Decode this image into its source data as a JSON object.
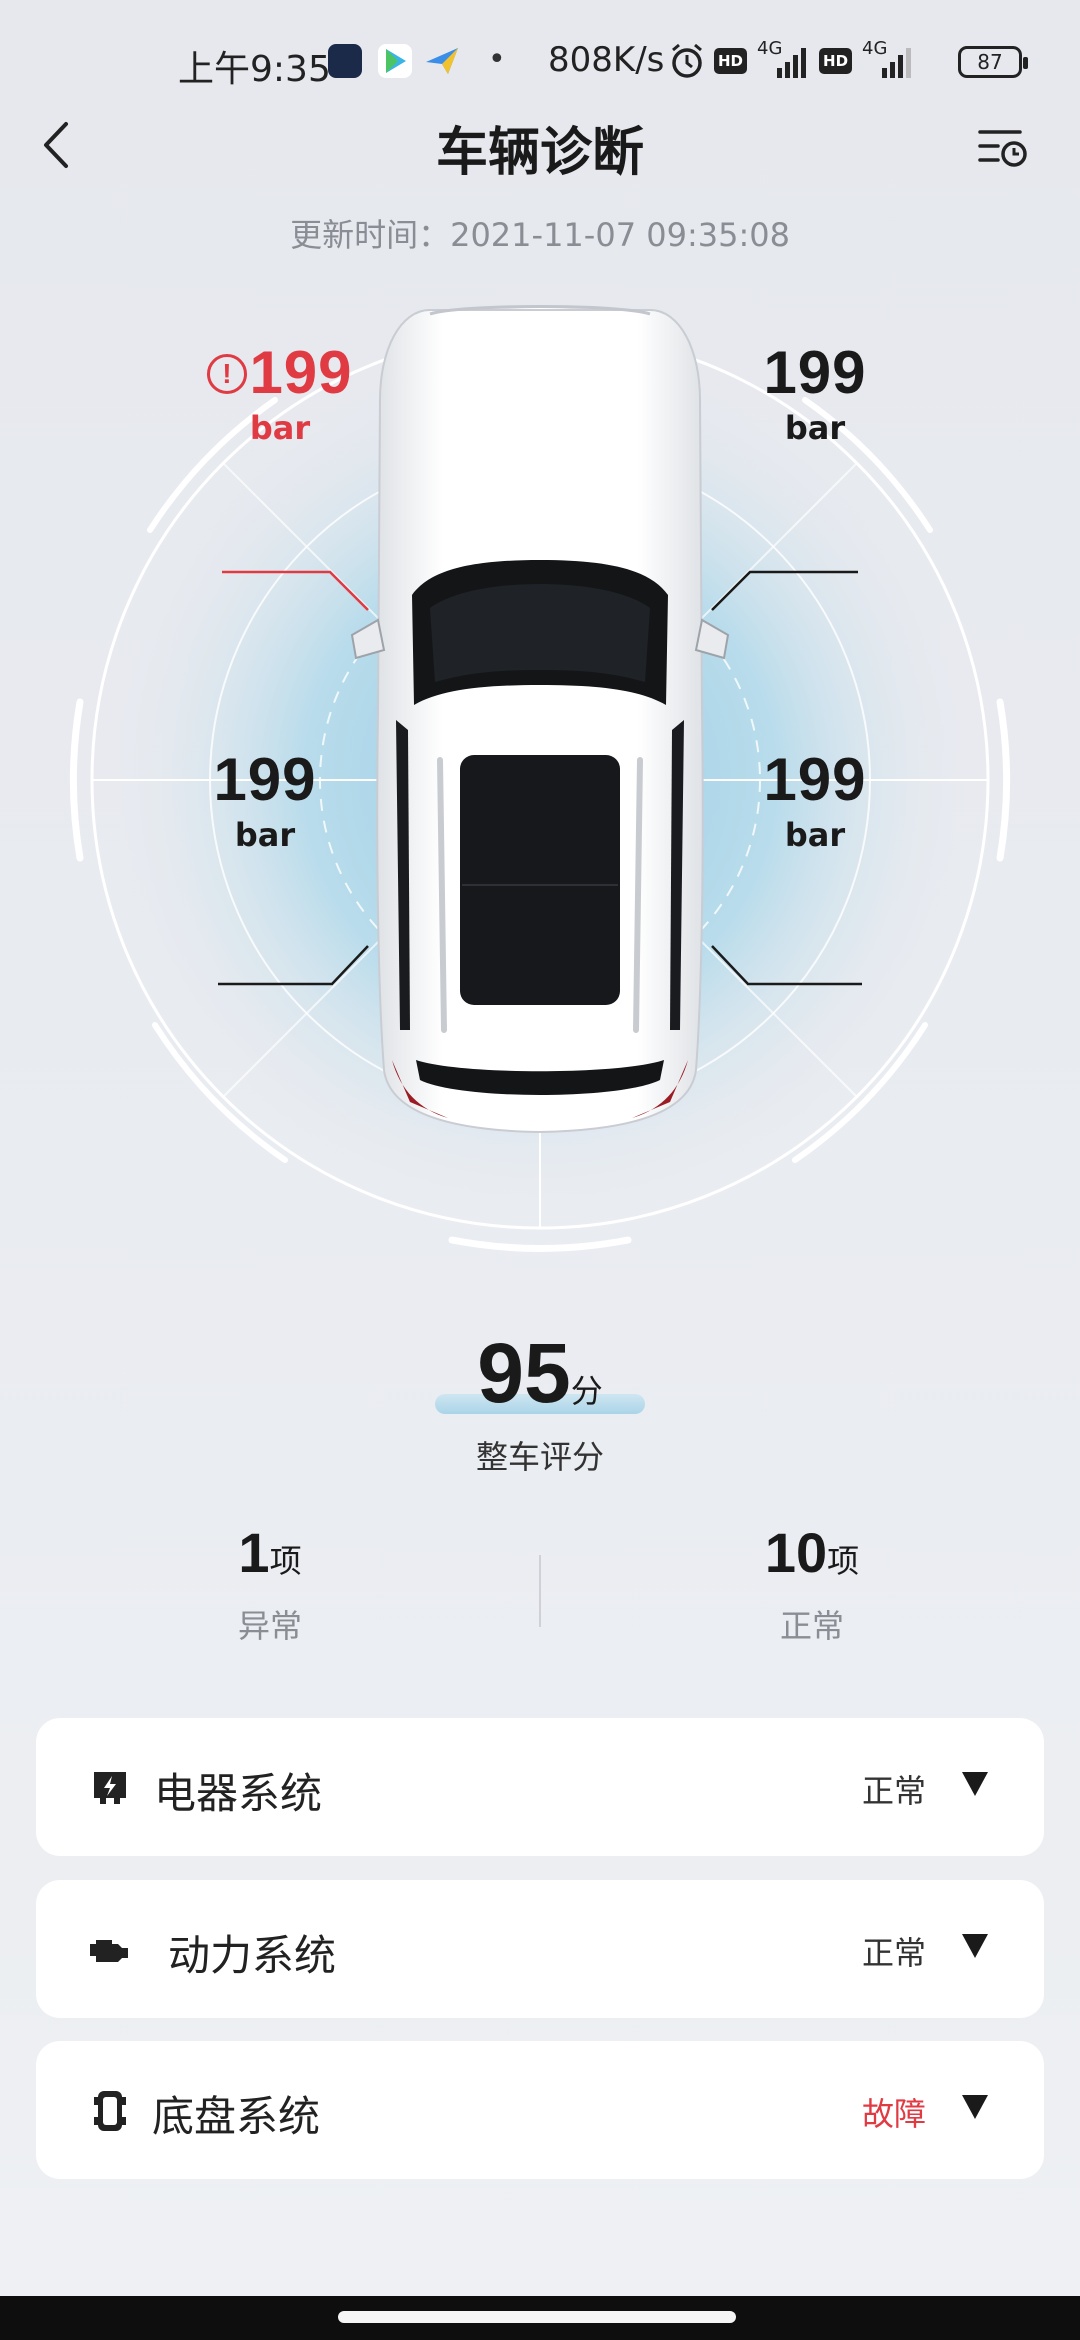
{
  "status_bar": {
    "time": "上午9:35",
    "net_speed": "808K/s",
    "hd1": "HD",
    "net1": "4G",
    "hd2": "HD",
    "net2": "4G",
    "battery": "87"
  },
  "header": {
    "title": "车辆诊断",
    "update_label": "更新时间：",
    "update_time": "2021-11-07 09:35:08"
  },
  "tires": {
    "front_left": {
      "value": "199",
      "unit": "bar",
      "status": "alert"
    },
    "front_right": {
      "value": "199",
      "unit": "bar",
      "status": "normal"
    },
    "rear_left": {
      "value": "199",
      "unit": "bar",
      "status": "normal"
    },
    "rear_right": {
      "value": "199",
      "unit": "bar",
      "status": "normal"
    }
  },
  "warning_symbol": "!",
  "score": {
    "value": "95",
    "unit": "分",
    "label": "整车评分"
  },
  "stats": {
    "abnormal": {
      "count": "1",
      "unit": "项",
      "label": "异常"
    },
    "normal": {
      "count": "10",
      "unit": "项",
      "label": "正常"
    }
  },
  "systems": [
    {
      "name": "电器系统",
      "status": "正常",
      "icon": "electrical-icon"
    },
    {
      "name": "动力系统",
      "status": "正常",
      "icon": "engine-icon"
    },
    {
      "name": "底盘系统",
      "status": "故障",
      "icon": "chassis-icon"
    }
  ],
  "colors": {
    "alert": "#e03a43",
    "accent_glow": "#a9d4e8",
    "card_bg": "#ffffff"
  }
}
